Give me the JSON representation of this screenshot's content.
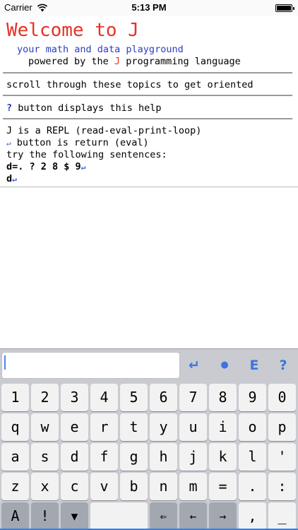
{
  "status_bar": {
    "carrier": "Carrier",
    "time": "5:13 PM"
  },
  "help": {
    "title": "Welcome to J",
    "subtitle": "your math and data playground",
    "powered_prefix": "powered by the ",
    "powered_j": "J",
    "powered_suffix": " programming language",
    "scroll_text": "scroll through these topics to get oriented",
    "help_key": "?",
    "help_text": " button displays this help",
    "repl_text": "J is a REPL (read-eval-print-loop)",
    "return_symbol": "↵",
    "return_text": " button is return (eval)",
    "try_text": "try the following sentences:",
    "sentence1": "d=. ? 2 8 $ 9",
    "sentence2": "d"
  },
  "keyboard": {
    "input_value": "",
    "toolbar": [
      "↵",
      "●",
      "E",
      "?"
    ],
    "row1": [
      "1",
      "2",
      "3",
      "4",
      "5",
      "6",
      "7",
      "8",
      "9",
      "0"
    ],
    "row2": [
      "q",
      "w",
      "e",
      "r",
      "t",
      "y",
      "u",
      "i",
      "o",
      "p"
    ],
    "row3": [
      "a",
      "s",
      "d",
      "f",
      "g",
      "h",
      "j",
      "k",
      "l",
      "'"
    ],
    "row4": [
      "z",
      "x",
      "c",
      "v",
      "b",
      "n",
      "m",
      "=",
      ".",
      ":"
    ],
    "row5": {
      "shift": "A",
      "bang": "!",
      "down": "▼",
      "space": "",
      "backspace": "⇐",
      "left": "←",
      "right": "→",
      "comma": ",",
      "underscore": "_"
    }
  }
}
